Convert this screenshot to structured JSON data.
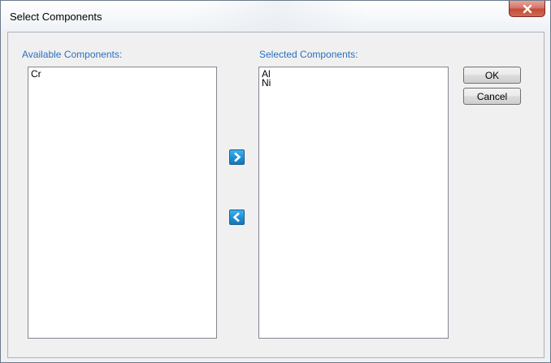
{
  "window": {
    "title": "Select Components",
    "close_icon": "close-x-icon"
  },
  "available": {
    "label": "Available Components:",
    "items": [
      "Cr"
    ]
  },
  "selected": {
    "label": "Selected Components:",
    "items": [
      "Al",
      "Ni"
    ]
  },
  "buttons": {
    "ok": "OK",
    "cancel": "Cancel",
    "add_icon": "arrow-right-icon",
    "remove_icon": "arrow-left-icon"
  },
  "colors": {
    "label_blue": "#2a6fc0",
    "arrow_blue": "#1d8fd6",
    "close_red": "#c44a3a"
  }
}
